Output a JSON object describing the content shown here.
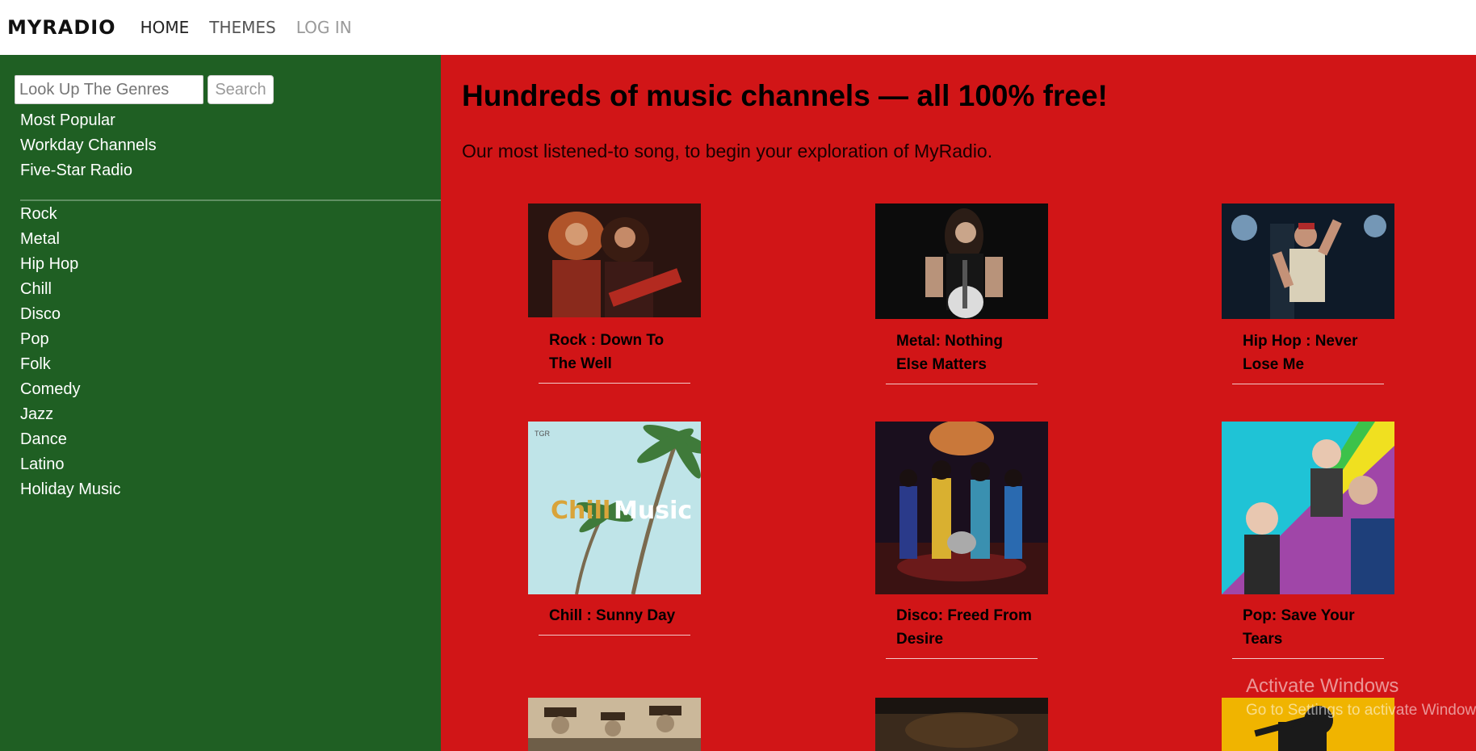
{
  "nav": {
    "brand": "MYRADIO",
    "links": [
      "HOME",
      "THEMES",
      "LOG IN"
    ]
  },
  "sidebar": {
    "search": {
      "placeholder": "Look Up The Genres",
      "button": "Search"
    },
    "featured": [
      "Most Popular",
      "Workday Channels",
      "Five-Star Radio"
    ],
    "genres": [
      "Rock",
      "Metal",
      "Hip Hop",
      "Chill",
      "Disco",
      "Pop",
      "Folk",
      "Comedy",
      "Jazz",
      "Dance",
      "Latino",
      "Holiday Music"
    ]
  },
  "main": {
    "headline": "Hundreds of music channels — all 100% free!",
    "subline": "Our most listened-to song, to begin your exploration of MyRadio.",
    "cards": [
      {
        "title": "Rock : Down To The Well",
        "image": "rock-concert-photo"
      },
      {
        "title": "Metal: Nothing Else Matters",
        "image": "metal-guitarist-photo"
      },
      {
        "title": "Hip Hop : Never Lose Me",
        "image": "hiphop-performer-photo"
      },
      {
        "title": "Chill : Sunny Day",
        "image": "chill-music-palm-cover",
        "cover_text": [
          "Chill",
          "Music"
        ],
        "badge": "TGR"
      },
      {
        "title": "Disco: Freed From Desire",
        "image": "disco-band-photo"
      },
      {
        "title": "Pop: Save Your Tears",
        "image": "pop-collage-cover"
      },
      {
        "title": "",
        "image": "folk-vintage-photo"
      },
      {
        "title": "",
        "image": "comedy-dark-photo"
      },
      {
        "title": "",
        "image": "jazz-saxophone-cover"
      }
    ]
  },
  "watermark": {
    "line1": "Activate Windows",
    "line2": "Go to Settings to activate Windows."
  },
  "colors": {
    "sidebar": "#1f5f23",
    "main": "#d11517"
  }
}
